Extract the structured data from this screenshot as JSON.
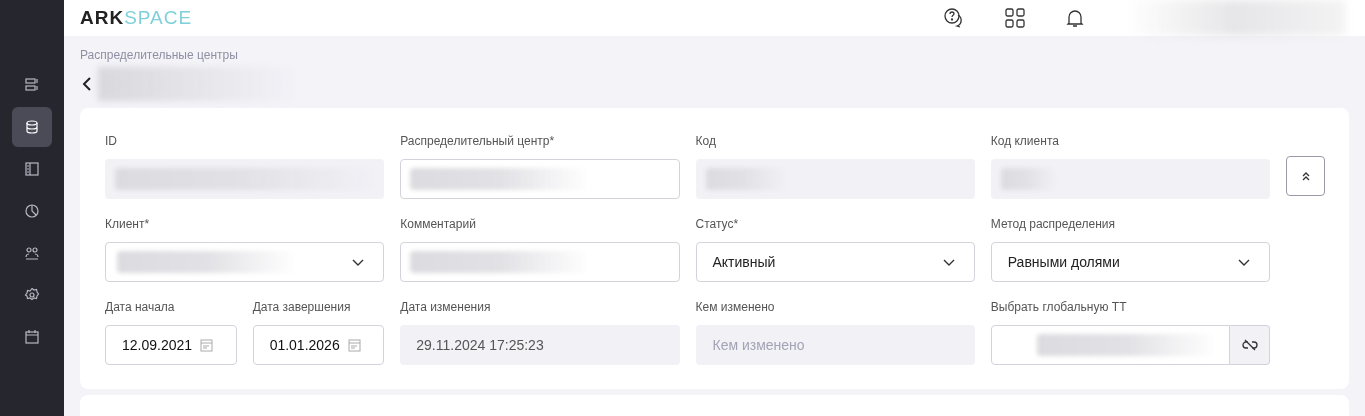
{
  "header": {
    "logo_dark": "ARK",
    "logo_light": "SPACE",
    "user_blurred": true
  },
  "sidebar": {
    "items": [
      {
        "selected": false
      },
      {
        "selected": true
      },
      {
        "selected": false
      },
      {
        "selected": false
      },
      {
        "selected": false
      },
      {
        "selected": false
      },
      {
        "selected": false
      }
    ]
  },
  "breadcrumb": "Распределительные центры",
  "title_blurred": true,
  "form": {
    "rows": [
      [
        {
          "label": "ID",
          "kind": "readonly",
          "blurred": true
        },
        {
          "label": "Распределительный центр*",
          "kind": "input",
          "blurred": true
        },
        {
          "label": "Код",
          "kind": "readonly",
          "blurred": true
        },
        {
          "label": "Код клиента",
          "kind": "readonly",
          "blurred": true
        }
      ],
      [
        {
          "label": "Клиент*",
          "kind": "select",
          "blurred": true
        },
        {
          "label": "Комментарий",
          "kind": "input",
          "blurred": true
        },
        {
          "label": "Статус*",
          "kind": "select",
          "value": "Активный"
        },
        {
          "label": "Метод распределения",
          "kind": "select",
          "value": "Равными долями"
        }
      ],
      [
        {
          "kind": "pair",
          "fields": [
            {
              "label": "Дата начала",
              "kind": "date",
              "value": "12.09.2021"
            },
            {
              "label": "Дата завершения",
              "kind": "date",
              "value": "01.01.2026"
            }
          ]
        },
        {
          "label": "Дата изменения",
          "kind": "readonly",
          "value": "29.11.2024 17:25:23"
        },
        {
          "label": "Кем изменено",
          "kind": "readonly",
          "placeholder": "Кем изменено"
        },
        {
          "label": "Выбрать глобальную ТТ",
          "kind": "link",
          "blurred": true
        }
      ]
    ]
  }
}
